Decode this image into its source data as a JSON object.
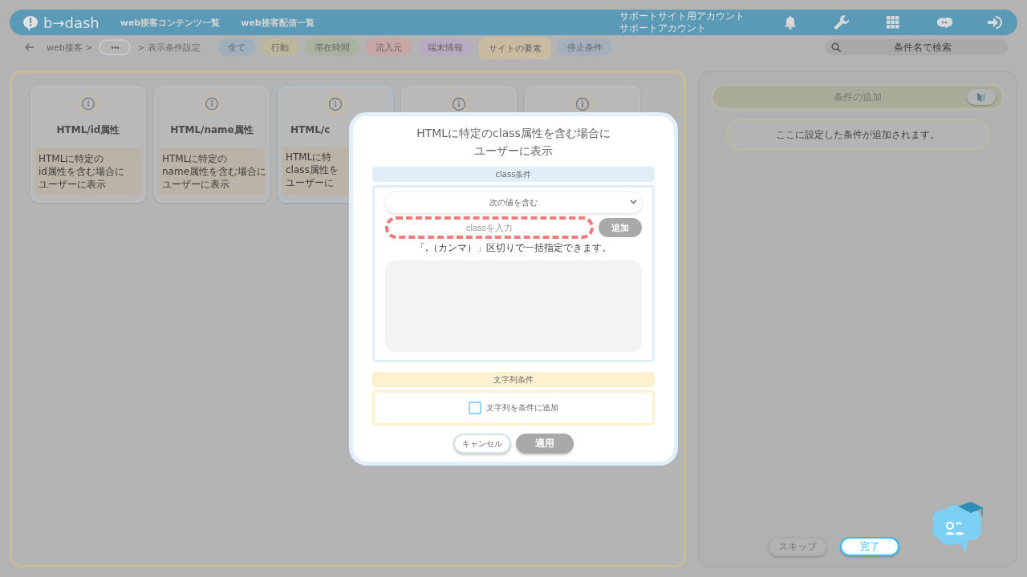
{
  "header": {
    "logo": "b→dash",
    "nav": [
      "web接客コンテンツ一覧",
      "web接客配信一覧"
    ],
    "account": [
      "サポートサイト用アカウント",
      "サポートアカウント"
    ]
  },
  "breadcrumb": {
    "item": "web接客 >",
    "more": "•••",
    "current": "> 表示条件設定"
  },
  "filter_tabs": [
    {
      "label": "全て",
      "selected": false,
      "color": "#9fb0bd"
    },
    {
      "label": "行動",
      "selected": false,
      "color": "#bdb89c"
    },
    {
      "label": "滞在時間",
      "selected": false,
      "color": "#a9b3a0"
    },
    {
      "label": "流入元",
      "selected": false,
      "color": "#c9a6a6"
    },
    {
      "label": "端末情報",
      "selected": false,
      "color": "#b8abc1"
    },
    {
      "label": "サイトの要素",
      "selected": true,
      "color": "#c9bba2"
    },
    {
      "label": "停止条件",
      "selected": false,
      "color": "#a3afba"
    }
  ],
  "search": {
    "placeholder": "条件名で検索"
  },
  "cards": [
    {
      "title": "HTML/id属性",
      "description": [
        "HTMLに特定の",
        "id属性を含む場合に",
        "ユーザーに表示"
      ],
      "selected": false
    },
    {
      "title": "HTML/name属性",
      "description": [
        "HTMLに特定の",
        "name属性を含む場合に",
        "ユーザーに表示"
      ],
      "selected": false
    },
    {
      "title": "HTML/c",
      "description": [
        "HTMLに特",
        "class属性を",
        "ユーザーに"
      ],
      "selected": true
    },
    {
      "selected": false
    },
    {
      "selected": false
    }
  ],
  "dialog": {
    "title": [
      "HTMLに特定のclass属性を含む場合に",
      "ユーザーに表示"
    ],
    "class_section": {
      "title": "class条件",
      "match_select": "次の値を含む",
      "input": {
        "placeholder": "classを入力",
        "error": true
      },
      "add_button": {
        "label": "追加",
        "disabled": true
      },
      "hint": "「,（カンマ）」区切りで一括指定できます。"
    },
    "string_section": {
      "title": "文字列条件",
      "checkbox": {
        "label": "文字列を条件に追加",
        "checked": false
      }
    },
    "buttons": [
      {
        "label": "キャンセル",
        "disabled": false
      },
      {
        "label": "適用",
        "disabled": true
      }
    ]
  },
  "side_panel": {
    "title": "条件の追加",
    "beginner_toggle": {
      "on": true
    },
    "message": "ここに設定した条件が追加されます。",
    "buttons": [
      {
        "label": "スキップ",
        "kind": "secondary"
      },
      {
        "label": "完了",
        "kind": "primary"
      }
    ]
  }
}
